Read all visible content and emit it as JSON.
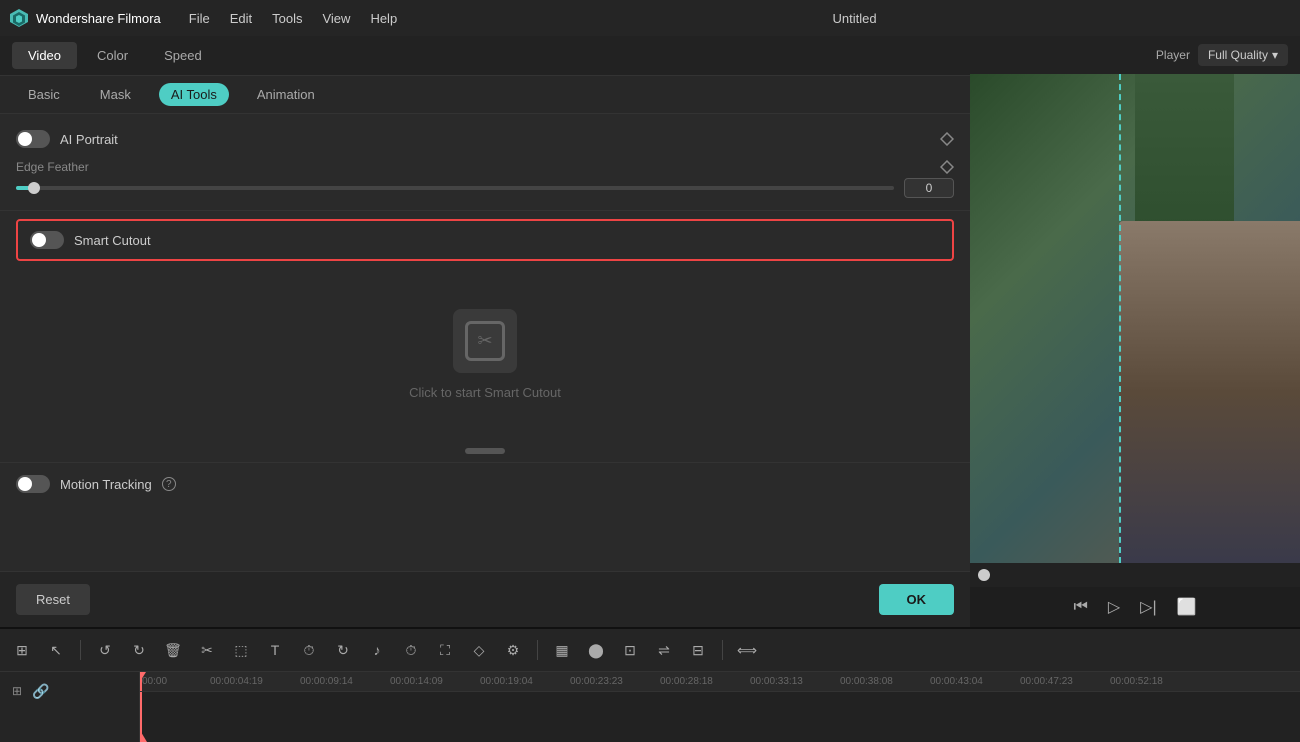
{
  "app": {
    "name": "Wondershare Filmora",
    "title": "Untitled"
  },
  "menu": {
    "items": [
      "File",
      "Edit",
      "Tools",
      "View",
      "Help"
    ]
  },
  "tabs": {
    "top": [
      "Video",
      "Color",
      "Speed"
    ],
    "active_top": "Video",
    "sub": [
      "Basic",
      "Mask",
      "AI Tools",
      "Animation"
    ],
    "active_sub": "AI Tools"
  },
  "ai_portrait": {
    "label": "AI Portrait",
    "enabled": false,
    "edge_feather": {
      "label": "Edge Feather",
      "value": "0",
      "min": 0,
      "max": 100,
      "percent": 2
    }
  },
  "smart_cutout": {
    "label": "Smart Cutout",
    "enabled": false,
    "placeholder_text": "Click to start Smart Cutout"
  },
  "motion_tracking": {
    "label": "Motion Tracking",
    "enabled": false,
    "help": "?"
  },
  "buttons": {
    "reset": "Reset",
    "ok": "OK"
  },
  "player": {
    "label": "Player",
    "quality": "Full Quality"
  },
  "timeline": {
    "tools": [
      {
        "name": "split-tool",
        "icon": "⊞"
      },
      {
        "name": "select-tool",
        "icon": "↖"
      },
      {
        "name": "separator1"
      },
      {
        "name": "undo-btn",
        "icon": "↺"
      },
      {
        "name": "redo-btn",
        "icon": "↻"
      },
      {
        "name": "delete-btn",
        "icon": "🗑"
      },
      {
        "name": "cut-btn",
        "icon": "✂"
      },
      {
        "name": "crop-btn",
        "icon": "⬚"
      },
      {
        "name": "text-btn",
        "icon": "T"
      },
      {
        "name": "timer-btn",
        "icon": "⏱"
      },
      {
        "name": "rotate-btn",
        "icon": "↻"
      },
      {
        "name": "audio-btn",
        "icon": "♫"
      },
      {
        "name": "speed-btn",
        "icon": "⏱"
      },
      {
        "name": "fullscreen-btn",
        "icon": "⛶"
      },
      {
        "name": "shape-btn",
        "icon": "◇"
      },
      {
        "name": "adjust-btn",
        "icon": "⚙"
      },
      {
        "name": "separator2"
      },
      {
        "name": "audio2-btn",
        "icon": "▦"
      },
      {
        "name": "record-btn",
        "icon": "⬤"
      },
      {
        "name": "group-btn",
        "icon": "⊡"
      },
      {
        "name": "flip-btn",
        "icon": "⇌"
      },
      {
        "name": "replace-btn",
        "icon": "⊟"
      },
      {
        "name": "separator3"
      },
      {
        "name": "adjust2-btn",
        "icon": "⟺"
      }
    ],
    "ruler_marks": [
      "00:00",
      "00:00:04:19",
      "00:00:09:14",
      "00:00:14:09",
      "00:00:19:04",
      "00:00:23:23",
      "00:00:28:18",
      "00:00:33:13",
      "00:00:38:08",
      "00:00:43:04",
      "00:00:47:23",
      "00:00:52:18"
    ]
  }
}
